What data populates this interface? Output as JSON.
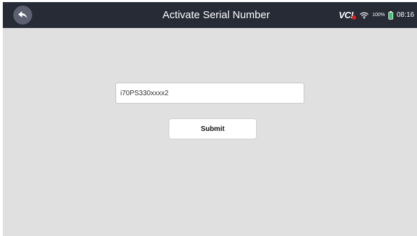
{
  "header": {
    "title": "Activate Serial Number",
    "back_icon": "back-arrow-icon",
    "background": "#262b36"
  },
  "status_bar": {
    "vci_label": "VC!",
    "vci_status_color": "#e02020",
    "wifi_icon": "wifi-icon",
    "battery_percent": "100%",
    "battery_icon": "battery-icon",
    "battery_color": "#3ec46d",
    "time": "08:16"
  },
  "form": {
    "serial_value": "i70PS330xxxx2",
    "submit_label": "Submit"
  },
  "theme": {
    "content_background": "#e0e0e0"
  }
}
